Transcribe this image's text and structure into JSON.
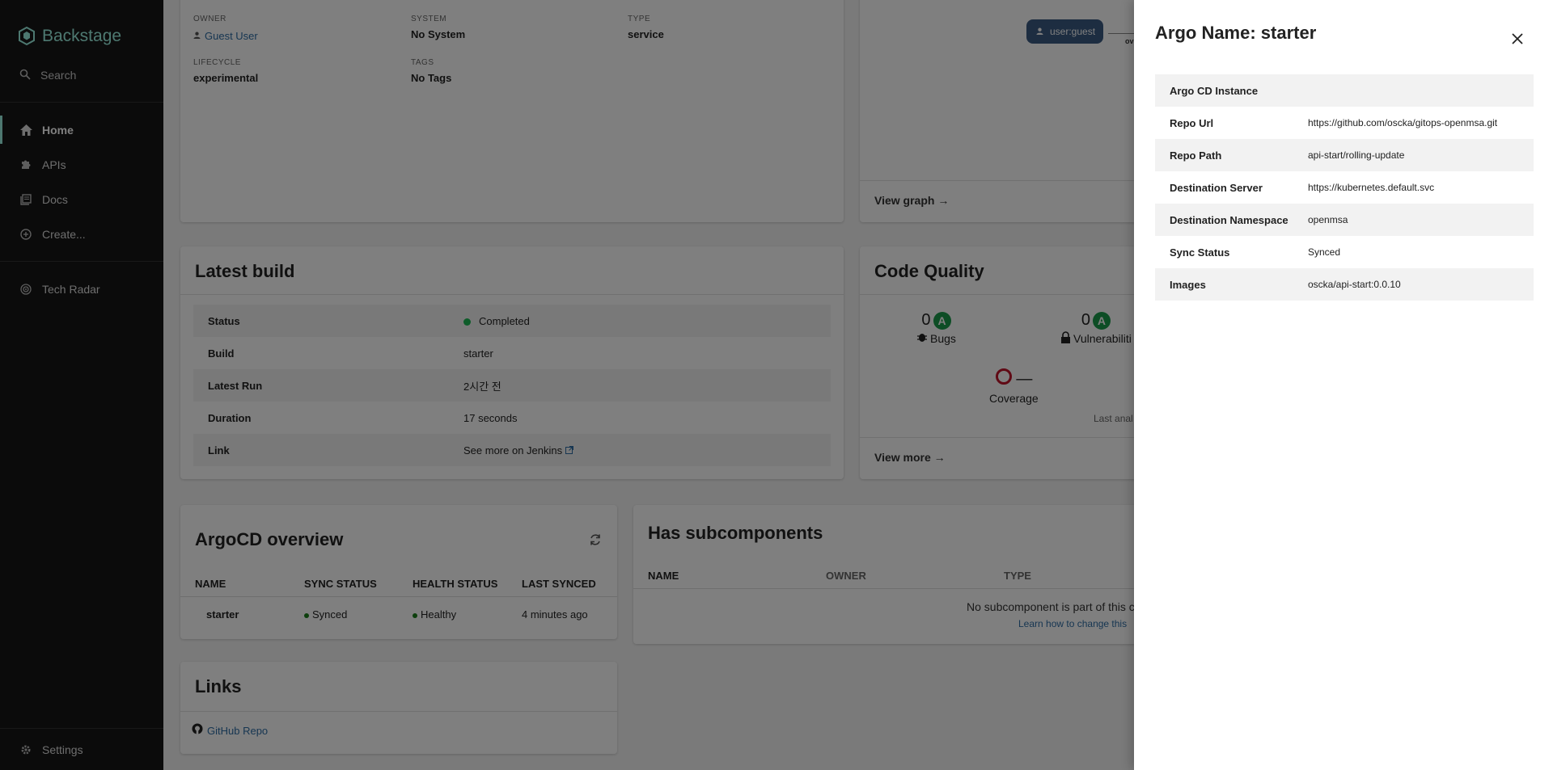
{
  "sidebar": {
    "brand": "Backstage",
    "search": "Search",
    "items": [
      {
        "label": "Home",
        "icon": "home-icon"
      },
      {
        "label": "APIs",
        "icon": "puzzle-icon"
      },
      {
        "label": "Docs",
        "icon": "docs-icon"
      },
      {
        "label": "Create...",
        "icon": "plus-circle-icon"
      }
    ],
    "tech_radar": "Tech Radar",
    "settings": "Settings"
  },
  "about": {
    "owner_label": "OWNER",
    "owner_value": "Guest User",
    "system_label": "SYSTEM",
    "system_value": "No System",
    "type_label": "TYPE",
    "type_value": "service",
    "lifecycle_label": "LIFECYCLE",
    "lifecycle_value": "experimental",
    "tags_label": "TAGS",
    "tags_value": "No Tags"
  },
  "relations": {
    "user_chip": "user:guest",
    "partial_label": "ov",
    "view_graph": "View graph →"
  },
  "latest_build": {
    "title": "Latest build",
    "rows": [
      {
        "k": "Status",
        "v": "Completed"
      },
      {
        "k": "Build",
        "v": "starter"
      },
      {
        "k": "Latest Run",
        "v": "2시간 전"
      },
      {
        "k": "Duration",
        "v": "17 seconds"
      },
      {
        "k": "Link",
        "v": "See more on Jenkins"
      }
    ]
  },
  "code_quality": {
    "title": "Code Quality",
    "bugs_value": "0",
    "bugs_grade": "A",
    "bugs_label": "Bugs",
    "vuln_value": "0",
    "vuln_grade": "A",
    "vuln_label": "Vulnerabiliti",
    "coverage_value": "—",
    "coverage_label": "Coverage",
    "last_analysis": "Last anal",
    "view_more": "View more →"
  },
  "argocd": {
    "title": "ArgoCD overview",
    "headers": [
      "NAME",
      "SYNC STATUS",
      "HEALTH STATUS",
      "LAST SYNCED"
    ],
    "row": {
      "name": "starter",
      "sync": "Synced",
      "health": "Healthy",
      "last_synced": "4 minutes ago"
    }
  },
  "subcomponents": {
    "title": "Has subcomponents",
    "headers": [
      "NAME",
      "OWNER",
      "TYPE"
    ],
    "empty": "No subcomponent is part of this c",
    "learn": "Learn how to change this"
  },
  "links": {
    "title": "Links",
    "github": "GitHub Repo"
  },
  "drawer": {
    "title": "Argo Name: starter",
    "rows": [
      {
        "k": "Argo CD Instance",
        "v": ""
      },
      {
        "k": "Repo Url",
        "v": "https://github.com/oscka/gitops-openmsa.git"
      },
      {
        "k": "Repo Path",
        "v": "api-start/rolling-update"
      },
      {
        "k": "Destination Server",
        "v": "https://kubernetes.default.svc"
      },
      {
        "k": "Destination Namespace",
        "v": "openmsa"
      },
      {
        "k": "Sync Status",
        "v": "Synced"
      },
      {
        "k": "Images",
        "v": "oscka/api-start:0.0.10"
      }
    ]
  },
  "colors": {
    "brand": "#9BF0E1",
    "sidebar_bg": "#171717",
    "status_green": "#1db954",
    "grade_green": "#1a9b4b",
    "coverage_red": "#c0142b"
  }
}
